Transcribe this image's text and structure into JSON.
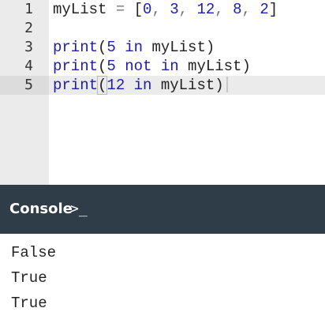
{
  "editor": {
    "lines": [
      {
        "number": "1",
        "tokens": [
          "myList",
          " = ",
          "[",
          "0",
          ", ",
          "3",
          ", ",
          "12",
          ", ",
          "8",
          ", ",
          "2",
          "]"
        ]
      },
      {
        "number": "2",
        "tokens": []
      },
      {
        "number": "3",
        "tokens": [
          "print",
          "(",
          "5",
          " in ",
          "myList",
          ")"
        ]
      },
      {
        "number": "4",
        "tokens": [
          "print",
          "(",
          "5",
          " not in ",
          "myList",
          ")"
        ]
      },
      {
        "number": "5",
        "tokens": [
          "print",
          "(",
          "12",
          " in ",
          "myList",
          ")"
        ]
      }
    ],
    "active_line": "5"
  },
  "console": {
    "title": "Console",
    "prompt_icon": "terminal-prompt-icon",
    "prompt_glyph": ">_",
    "output": [
      "False",
      "True",
      "True"
    ]
  },
  "colors": {
    "keyword": "#1c1cb5",
    "gutter": "#ebebeb",
    "console_header": "#2f3d48"
  }
}
